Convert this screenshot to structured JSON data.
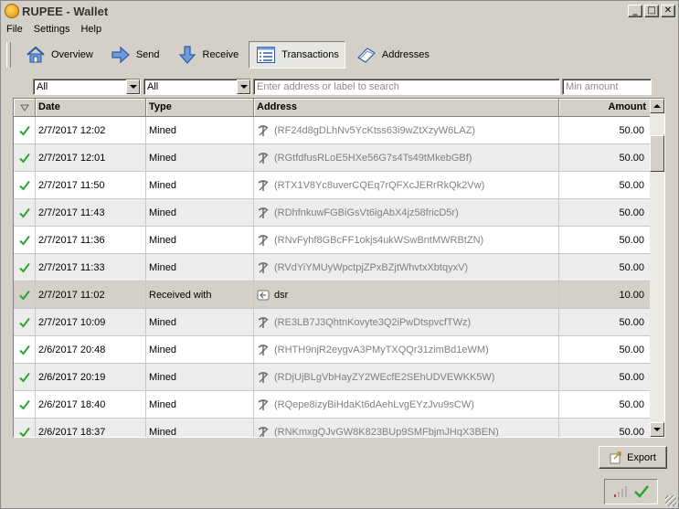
{
  "window": {
    "title": "RUPEE - Wallet",
    "minimize": "_",
    "maximize": "□",
    "close": "✕"
  },
  "menu": [
    "File",
    "Settings",
    "Help"
  ],
  "toolbar": [
    {
      "label": "Overview",
      "icon": "home-icon",
      "active": false
    },
    {
      "label": "Send",
      "icon": "send-arrow-icon",
      "active": false
    },
    {
      "label": "Receive",
      "icon": "receive-arrow-icon",
      "active": false
    },
    {
      "label": "Transactions",
      "icon": "transactions-list-icon",
      "active": true
    },
    {
      "label": "Addresses",
      "icon": "address-book-icon",
      "active": false
    }
  ],
  "filters": {
    "date_value": "All",
    "type_value": "All",
    "search_placeholder": "Enter address or label to search",
    "min_amount_placeholder": "Min amount"
  },
  "table": {
    "columns": [
      "",
      "Date",
      "Type",
      "Address",
      "Amount"
    ],
    "rows": [
      {
        "date": "2/7/2017 12:02",
        "type": "Mined",
        "address": "(RF24d8gDLhNv5YcKtss63i9wZtXzyW6LAZ)",
        "amount": "50.00",
        "kind": "mined"
      },
      {
        "date": "2/7/2017 12:01",
        "type": "Mined",
        "address": "(RGtfdfusRLoE5HXe56G7s4Ts49tMkebGBf)",
        "amount": "50.00",
        "kind": "mined"
      },
      {
        "date": "2/7/2017 11:50",
        "type": "Mined",
        "address": "(RTX1V8Yc8uverCQEq7rQFXcJERrRkQk2Vw)",
        "amount": "50.00",
        "kind": "mined"
      },
      {
        "date": "2/7/2017 11:43",
        "type": "Mined",
        "address": "(RDhfnkuwFGBiGsVt6igAbX4jz58fricD5r)",
        "amount": "50.00",
        "kind": "mined"
      },
      {
        "date": "2/7/2017 11:36",
        "type": "Mined",
        "address": "(RNvFyhf8GBcFF1okjs4ukWSwBntMWRBtZN)",
        "amount": "50.00",
        "kind": "mined"
      },
      {
        "date": "2/7/2017 11:33",
        "type": "Mined",
        "address": "(RVdYiYMUyWpctpjZPxBZjtWhvtxXbtqyxV)",
        "amount": "50.00",
        "kind": "mined"
      },
      {
        "date": "2/7/2017 11:02",
        "type": "Received with",
        "address": "dsr",
        "amount": "10.00",
        "kind": "received"
      },
      {
        "date": "2/7/2017 10:09",
        "type": "Mined",
        "address": "(RE3LB7J3QhtnKovyte3Q2iPwDtspvcfTWz)",
        "amount": "50.00",
        "kind": "mined"
      },
      {
        "date": "2/6/2017 20:48",
        "type": "Mined",
        "address": "(RHTH9njR2eygvA3PMyTXQQr31zimBd1eWM)",
        "amount": "50.00",
        "kind": "mined"
      },
      {
        "date": "2/6/2017 20:19",
        "type": "Mined",
        "address": "(RDjUjBLgVbHayZY2WEcfE2SEhUDVEWKK5W)",
        "amount": "50.00",
        "kind": "mined"
      },
      {
        "date": "2/6/2017 18:40",
        "type": "Mined",
        "address": "(RQepe8izyBiHdaKt6dAehLvgEYzJvu9sCW)",
        "amount": "50.00",
        "kind": "mined"
      },
      {
        "date": "2/6/2017 18:37",
        "type": "Mined",
        "address": "(RNKmxgQJvGW8K823BUp9SMFbjmJHqX3BEN)",
        "amount": "50.00",
        "kind": "mined"
      }
    ]
  },
  "export_label": "Export",
  "colors": {
    "check_green": "#2aa52a",
    "address_gray": "#808080",
    "selected_row": "#d4d0c8"
  }
}
